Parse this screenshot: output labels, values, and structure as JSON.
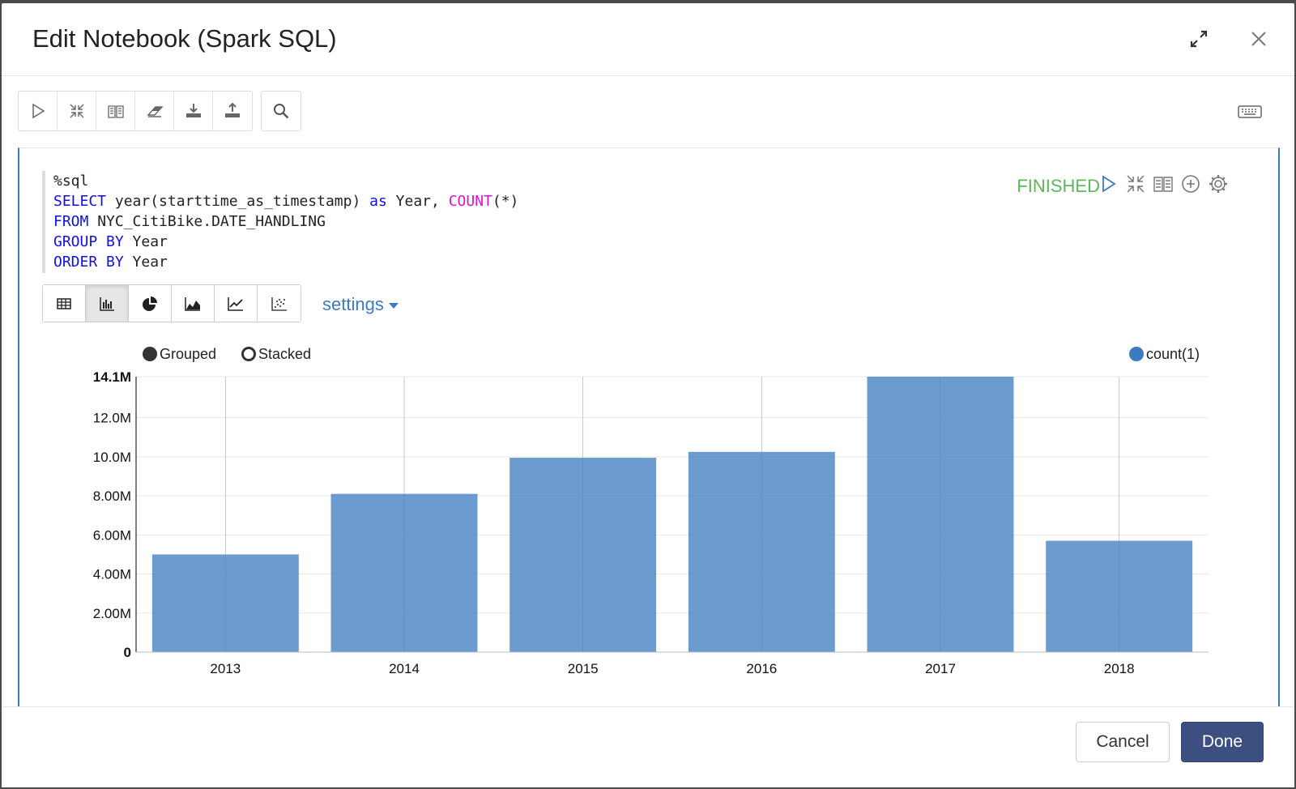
{
  "header": {
    "title": "Edit Notebook (Spark SQL)"
  },
  "toolbar": {
    "main_buttons": [
      "run-icon",
      "collapse-icon",
      "book-icon",
      "eraser-icon",
      "download-icon",
      "upload-icon"
    ],
    "search_button": "search-icon",
    "keyboard_button": "keyboard-icon"
  },
  "paragraph": {
    "code_lines": [
      [
        {
          "t": "%sql",
          "c": ""
        }
      ],
      [
        {
          "t": "SELECT",
          "c": "kw"
        },
        {
          "t": " year(starttime_as_timestamp) ",
          "c": ""
        },
        {
          "t": "as",
          "c": "kw"
        },
        {
          "t": " Year, ",
          "c": ""
        },
        {
          "t": "COUNT",
          "c": "fn"
        },
        {
          "t": "(*)",
          "c": ""
        }
      ],
      [
        {
          "t": "FROM",
          "c": "kw"
        },
        {
          "t": " NYC_CitiBike.DATE_HANDLING",
          "c": ""
        }
      ],
      [
        {
          "t": "GROUP BY",
          "c": "kw"
        },
        {
          "t": " Year",
          "c": ""
        }
      ],
      [
        {
          "t": "ORDER BY",
          "c": "kw"
        },
        {
          "t": " Year",
          "c": ""
        }
      ]
    ],
    "status": "FINISHED",
    "status_color": "#5cb85c",
    "controls": [
      "run-icon",
      "collapse-icon",
      "book-icon",
      "add-icon",
      "gear-icon"
    ]
  },
  "viz": {
    "buttons": [
      "table-icon",
      "bar-chart-icon",
      "pie-chart-icon",
      "area-chart-icon",
      "line-chart-icon",
      "scatter-chart-icon"
    ],
    "active": "bar-chart-icon",
    "settings_label": "settings"
  },
  "chart_controls": {
    "grouped_label": "Grouped",
    "stacked_label": "Stacked",
    "selected": "Grouped"
  },
  "chart_data": {
    "type": "bar",
    "categories": [
      "2013",
      "2014",
      "2015",
      "2016",
      "2017",
      "2018"
    ],
    "series": [
      {
        "name": "count(1)",
        "values": [
          5000000,
          8100000,
          9950000,
          10250000,
          14100000,
          5700000
        ],
        "color": "#3b7bbf"
      }
    ],
    "ylim": [
      0,
      14100000
    ],
    "yticks": [
      {
        "value": 0,
        "label": "0"
      },
      {
        "value": 2000000,
        "label": "2.00M"
      },
      {
        "value": 4000000,
        "label": "4.00M"
      },
      {
        "value": 6000000,
        "label": "6.00M"
      },
      {
        "value": 8000000,
        "label": "8.00M"
      },
      {
        "value": 10000000,
        "label": "10.0M"
      },
      {
        "value": 12000000,
        "label": "12.0M"
      },
      {
        "value": 14100000,
        "label": "14.1M"
      }
    ],
    "grid": true,
    "legend": "top-right"
  },
  "footer": {
    "cancel_label": "Cancel",
    "done_label": "Done"
  }
}
